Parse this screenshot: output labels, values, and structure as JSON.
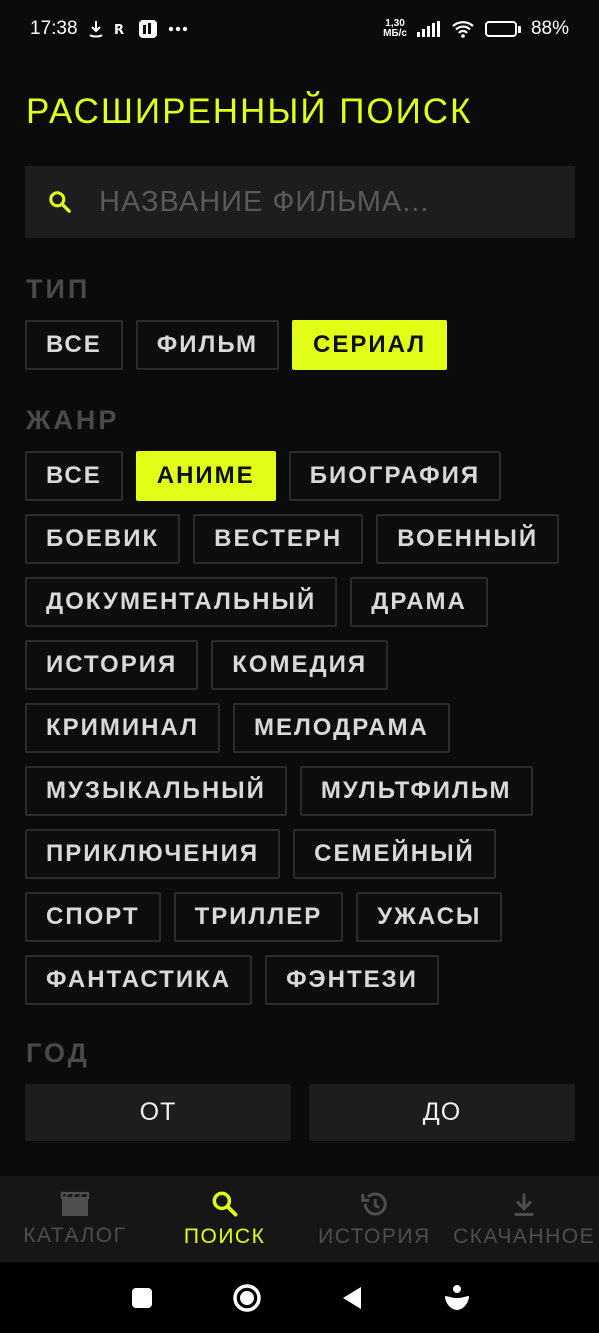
{
  "status_bar": {
    "time": "17:38",
    "network_speed_value": "1,30",
    "network_speed_unit": "МБ/с",
    "battery": "88%",
    "battery_level": 0.88,
    "icons": [
      "download-icon",
      "radio-icon",
      "app-icon",
      "more-dots-icon",
      "signal-icon",
      "wifi-icon",
      "battery-icon"
    ]
  },
  "page": {
    "title": "РАСШИРЕННЫЙ ПОИСК"
  },
  "search": {
    "value": "",
    "placeholder": "НАЗВАНИЕ ФИЛЬМА...",
    "icon": "search-icon"
  },
  "type_section": {
    "label": "ТИП",
    "selected": "СЕРИАЛ",
    "options": [
      "ВСЕ",
      "ФИЛЬМ",
      "СЕРИАЛ"
    ]
  },
  "genre_section": {
    "label": "ЖАНР",
    "selected": "АНИМЕ",
    "options": [
      "ВСЕ",
      "АНИМЕ",
      "БИОГРАФИЯ",
      "БОЕВИК",
      "ВЕСТЕРН",
      "ВОЕННЫЙ",
      "ДОКУМЕНТАЛЬНЫЙ",
      "ДРАМА",
      "ИСТОРИЯ",
      "КОМЕДИЯ",
      "КРИМИНАЛ",
      "МЕЛОДРАМА",
      "МУЗЫКАЛЬНЫЙ",
      "МУЛЬТФИЛЬМ",
      "ПРИКЛЮЧЕНИЯ",
      "СЕМЕЙНЫЙ",
      "СПОРТ",
      "ТРИЛЛЕР",
      "УЖАСЫ",
      "ФАНТАСТИКА",
      "ФЭНТЕЗИ"
    ]
  },
  "year_section": {
    "label": "ГОД",
    "from_label": "ОТ",
    "to_label": "ДО"
  },
  "bottom_nav": {
    "active": "ПОИСК",
    "items": [
      {
        "label": "КАТАЛОГ",
        "icon": "clapperboard-icon"
      },
      {
        "label": "ПОИСК",
        "icon": "search-icon"
      },
      {
        "label": "ИСТОРИЯ",
        "icon": "history-icon"
      },
      {
        "label": "СКАЧАННОЕ",
        "icon": "download-icon"
      }
    ]
  },
  "colors": {
    "accent": "#e2ff17",
    "background": "#0b0b0b",
    "surface": "#1d1d1d",
    "muted_label": "#4a4a4a",
    "inactive_nav": "#4e4e4e"
  }
}
